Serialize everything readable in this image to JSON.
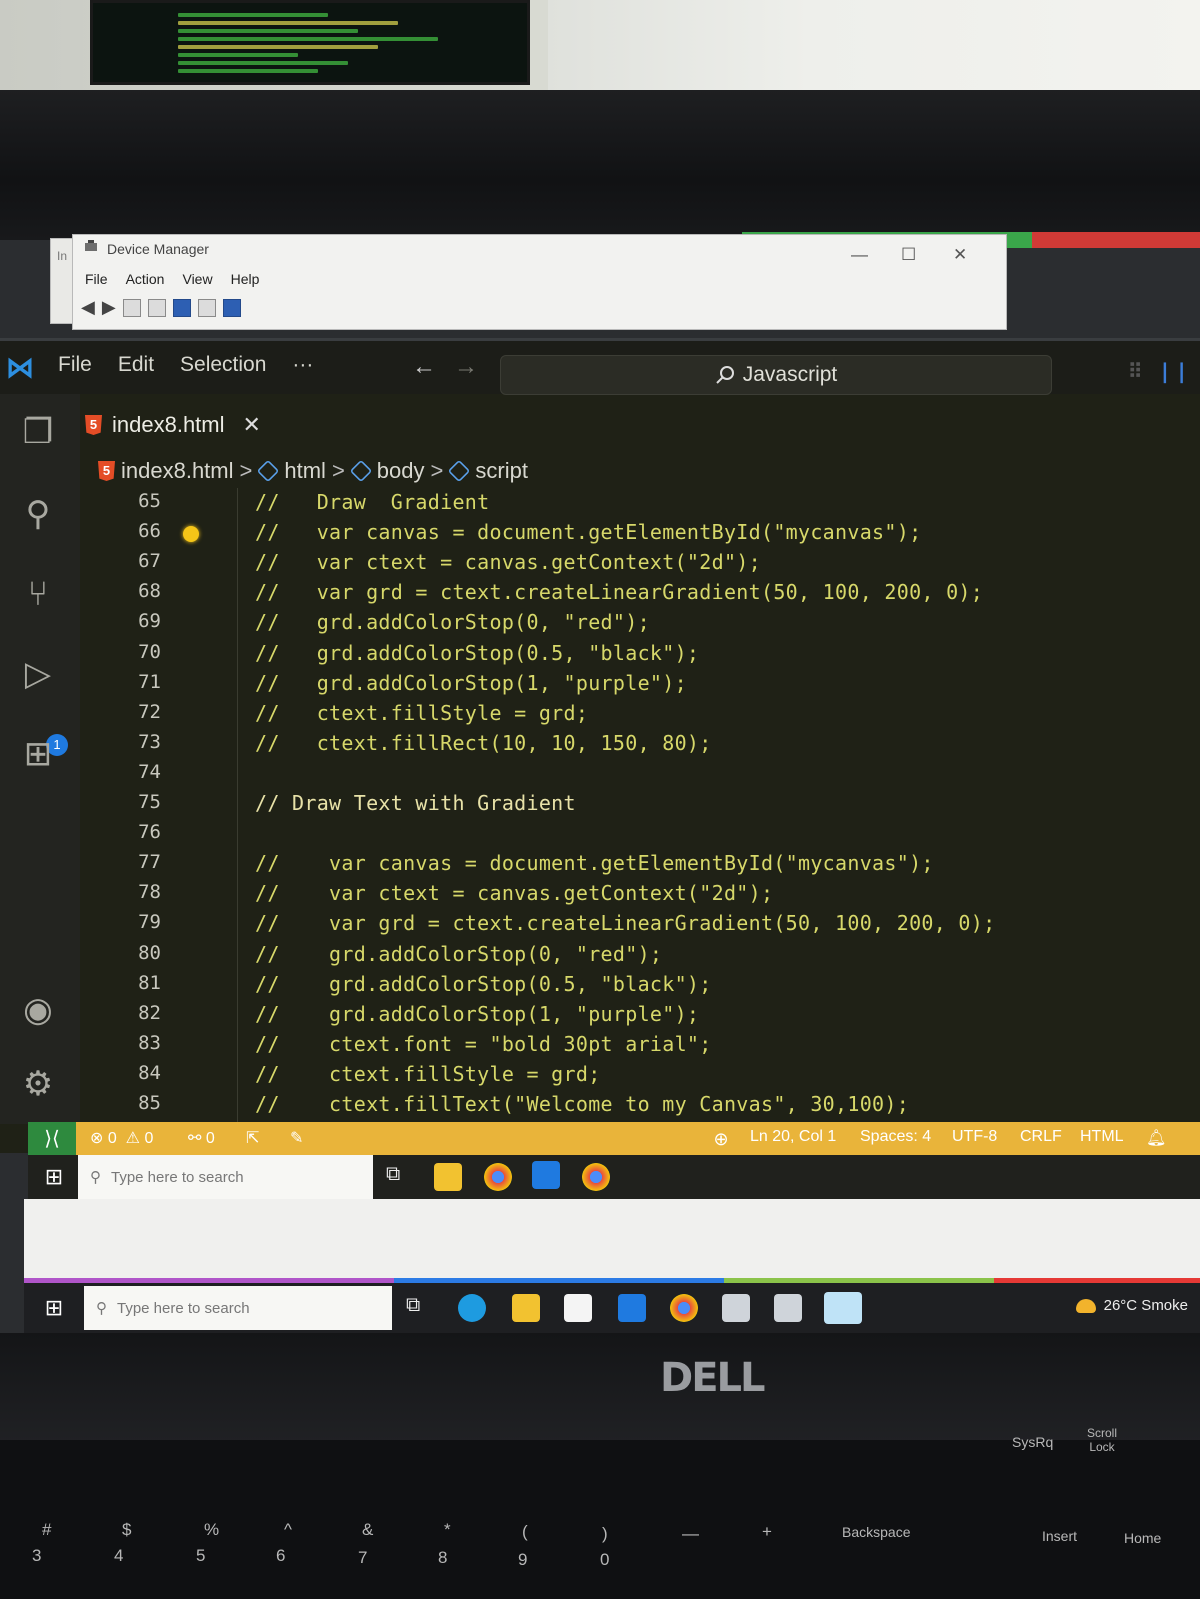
{
  "device_manager": {
    "title": "Device Manager",
    "side_fragment": "In",
    "menu": [
      "File",
      "Action",
      "View",
      "Help"
    ],
    "controls": {
      "minimize": "—",
      "maximize": "☐",
      "close": "✕"
    }
  },
  "vscode": {
    "menu": [
      "File",
      "Edit",
      "Selection",
      "···"
    ],
    "nav": {
      "back": "←",
      "forward": "→"
    },
    "command_center": "Javascript",
    "tab": {
      "filename": "index8.html",
      "close": "✕"
    },
    "breadcrumb": [
      "index8.html",
      "html",
      "body",
      "script"
    ],
    "accent_color": "#e9b43a",
    "code_lines": [
      {
        "num": "65",
        "text": "//   Draw  Gradient"
      },
      {
        "num": "66",
        "text": "//   var canvas = document.getElementById(\"mycanvas\");"
      },
      {
        "num": "67",
        "text": "//   var ctext = canvas.getContext(\"2d\");"
      },
      {
        "num": "68",
        "text": "//   var grd = ctext.createLinearGradient(50, 100, 200, 0);"
      },
      {
        "num": "69",
        "text": "//   grd.addColorStop(0, \"red\");"
      },
      {
        "num": "70",
        "text": "//   grd.addColorStop(0.5, \"black\");"
      },
      {
        "num": "71",
        "text": "//   grd.addColorStop(1, \"purple\");"
      },
      {
        "num": "72",
        "text": "//   ctext.fillStyle = grd;"
      },
      {
        "num": "73",
        "text": "//   ctext.fillRect(10, 10, 150, 80);"
      },
      {
        "num": "74",
        "text": ""
      },
      {
        "num": "75",
        "text": "// Draw Text with Gradient"
      },
      {
        "num": "76",
        "text": ""
      },
      {
        "num": "77",
        "text": "//    var canvas = document.getElementById(\"mycanvas\");"
      },
      {
        "num": "78",
        "text": "//    var ctext = canvas.getContext(\"2d\");"
      },
      {
        "num": "79",
        "text": "//    var grd = ctext.createLinearGradient(50, 100, 200, 0);"
      },
      {
        "num": "80",
        "text": "//    grd.addColorStop(0, \"red\");"
      },
      {
        "num": "81",
        "text": "//    grd.addColorStop(0.5, \"black\");"
      },
      {
        "num": "82",
        "text": "//    grd.addColorStop(1, \"purple\");"
      },
      {
        "num": "83",
        "text": "//    ctext.font = \"bold 30pt arial\";"
      },
      {
        "num": "84",
        "text": "//    ctext.fillStyle = grd;"
      },
      {
        "num": "85",
        "text": "//    ctext.fillText(\"Welcome to my Canvas\", 30,100);"
      }
    ],
    "status": {
      "errors": "0",
      "warnings": "0",
      "ports": "0",
      "position": "Ln 20, Col 1",
      "spaces": "Spaces: 4",
      "encoding": "UTF-8",
      "eol": "CRLF",
      "language": "HTML"
    }
  },
  "taskbar_inner": {
    "search_placeholder": "Type here to search"
  },
  "taskbar_outer": {
    "search_placeholder": "Type here to search",
    "weather": "26°C  Smoke"
  },
  "hardware": {
    "brand": "DELL",
    "keys": [
      "#",
      "3",
      "$",
      "4",
      "%",
      "5",
      "^",
      "6",
      "&",
      "7",
      "*",
      "8",
      "(",
      "9",
      ")",
      "0",
      "—",
      "+",
      "Backspace",
      "Insert",
      "Home",
      "SysRq",
      "Scroll Lock"
    ]
  }
}
